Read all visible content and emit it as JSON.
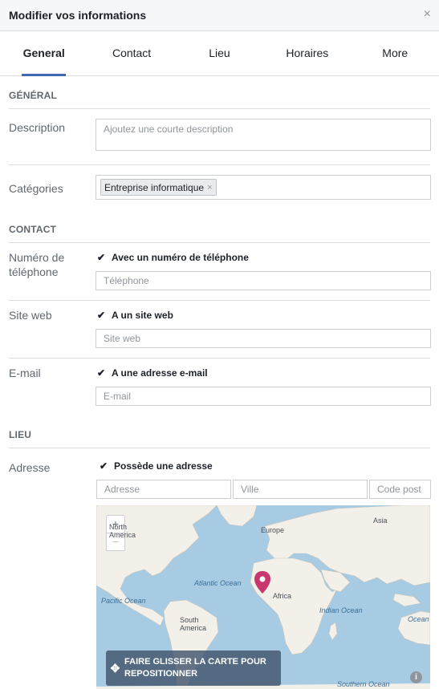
{
  "header": {
    "title": "Modifier vos informations",
    "close": "×"
  },
  "tabs": [
    {
      "label": "General",
      "active": true
    },
    {
      "label": "Contact",
      "active": false
    },
    {
      "label": "Lieu",
      "active": false
    },
    {
      "label": "Horaires",
      "active": false
    },
    {
      "label": "More",
      "active": false
    }
  ],
  "general": {
    "section_title": "GÉNÉRAL",
    "description_label": "Description",
    "description_placeholder": "Ajoutez une courte description",
    "categories_label": "Catégories",
    "category_tag": "Entreprise informatique",
    "tag_remove": "×"
  },
  "contact": {
    "section_title": "CONTACT",
    "phone_label": "Numéro de téléphone",
    "phone_check": "Avec un numéro de téléphone",
    "phone_placeholder": "Téléphone",
    "website_label": "Site web",
    "website_check": "A un site web",
    "website_placeholder": "Site web",
    "email_label": "E-mail",
    "email_check": "A une adresse e-mail",
    "email_placeholder": "E-mail"
  },
  "lieu": {
    "section_title": "LIEU",
    "address_label": "Adresse",
    "address_check": "Possède une adresse",
    "address_placeholder": "Adresse",
    "city_placeholder": "Ville",
    "zip_placeholder": "Code post"
  },
  "map": {
    "zoom_in": "+",
    "zoom_out": "−",
    "labels": {
      "north_america": "North America",
      "europe": "Europe",
      "asia": "Asia",
      "africa": "Africa",
      "south_america": "South America",
      "atlantic": "Atlantic Ocean",
      "pacific": "Pacific Ocean",
      "indian": "Indian Ocean",
      "southern": "Southern Ocean",
      "oceania": "Ocean"
    },
    "drag_hint": "FAIRE GLISSER LA CARTE POUR REPOSITIONNER",
    "info": "i"
  },
  "colors": {
    "accent": "#4267b2",
    "pin": "#c8386f",
    "water": "#a6cbe3",
    "land": "#f2f0e9"
  }
}
